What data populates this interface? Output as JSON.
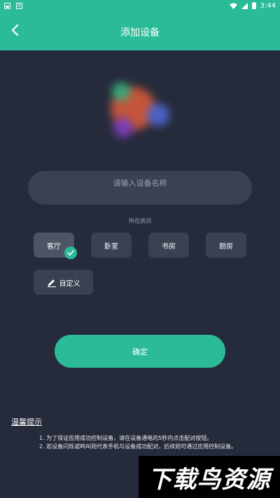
{
  "status_bar": {
    "time": "3:44"
  },
  "header": {
    "title": "添加设备",
    "back_icon": "chevron-left-icon"
  },
  "device_name_input": {
    "value": "",
    "placeholder": "请输入设备名称"
  },
  "rooms": {
    "label": "所在房间",
    "options": [
      {
        "label": "客厅",
        "selected": true
      },
      {
        "label": "卧室",
        "selected": false
      },
      {
        "label": "书房",
        "selected": false
      },
      {
        "label": "厨房",
        "selected": false
      }
    ],
    "custom_label": "自定义"
  },
  "confirm_label": "确定",
  "tips": {
    "title": "温馨提示",
    "items": [
      "1. 为了保证应用成功控制设备，请在设备通电的5秒内点击配对按钮。",
      "2. 若设备闪烁或鸣叫则代表手机与设备成功配对，后续则可通过应用控制设备。"
    ]
  },
  "watermark": "下载鸟资源",
  "colors": {
    "accent": "#2bbb98",
    "background": "#262b3b",
    "surface": "#3a4153"
  }
}
